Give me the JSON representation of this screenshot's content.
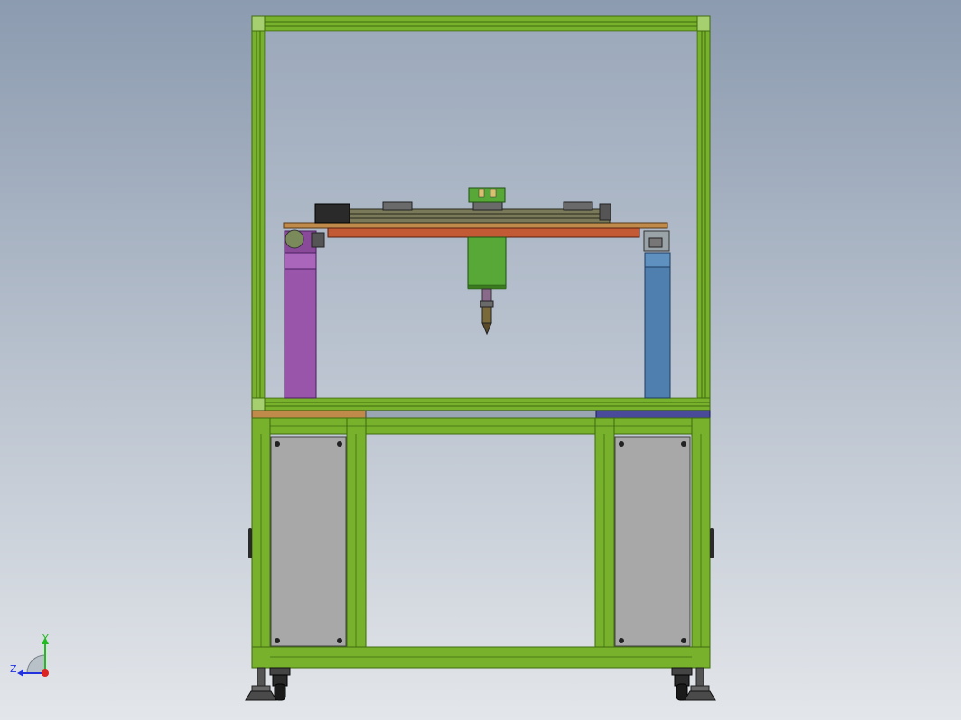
{
  "viewport": {
    "background_top": "#8c9bb0",
    "background_bottom": "#e3e6ea"
  },
  "model": {
    "name": "",
    "colors": {
      "frame_green": "#78b22c",
      "frame_green_dark": "#3f6b10",
      "panel_gray": "#a8a8a8",
      "rail_orange": "#c25a36",
      "plate_tan": "#c08a4a",
      "column_purple": "#9955aa",
      "column_blue": "#4e7fae",
      "spindle_green": "#58a838",
      "motor_black": "#2a2a2a",
      "caster_dark": "#333333"
    }
  },
  "triad": {
    "y_label": "Y",
    "z_label": "Z",
    "y_color": "#22bb22",
    "z_color": "#2233dd",
    "x_color": "#dd2222"
  }
}
